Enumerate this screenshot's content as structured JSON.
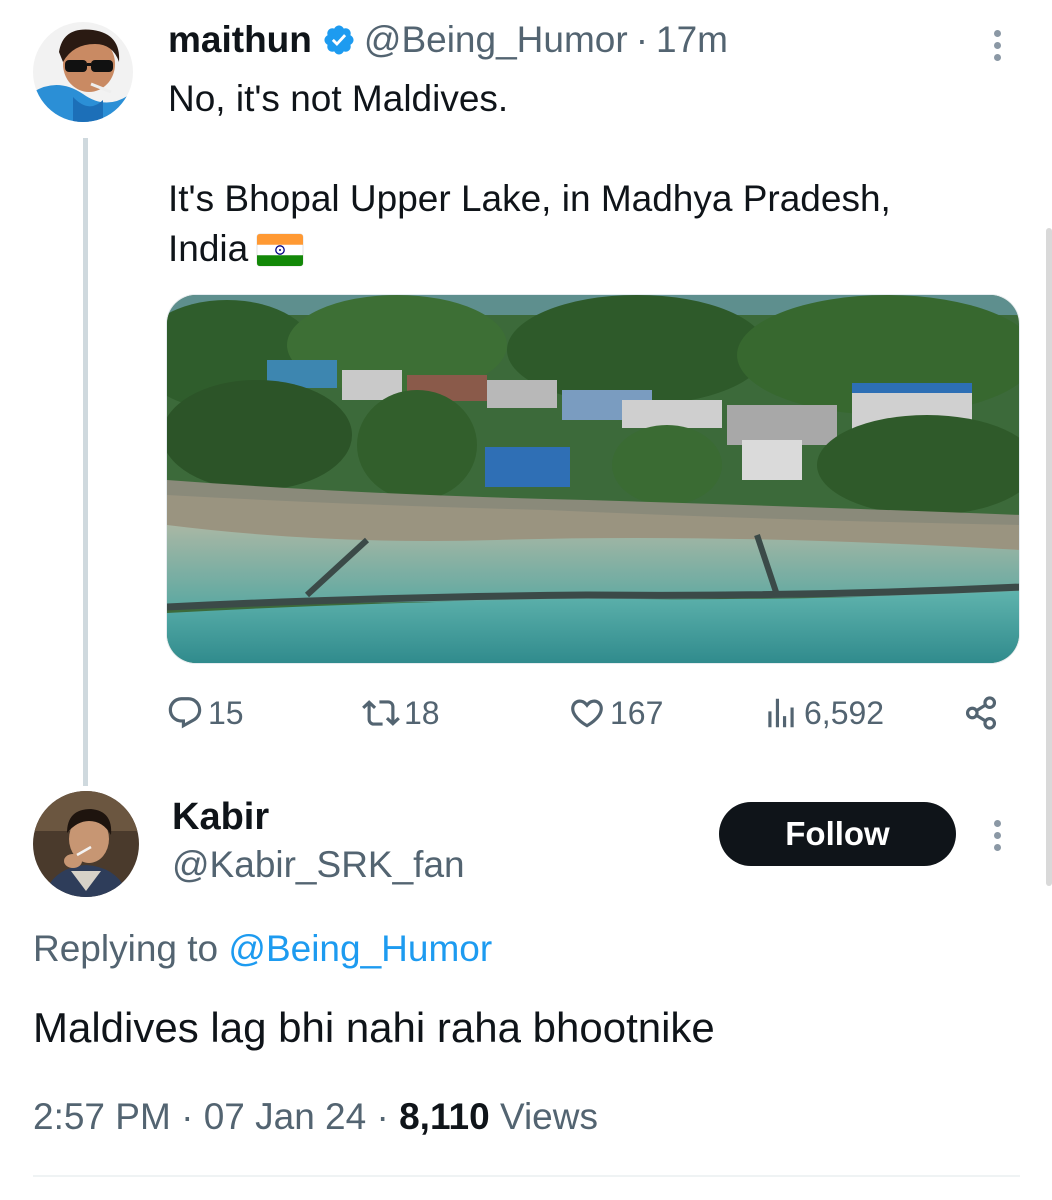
{
  "parent_tweet": {
    "display_name": "maithun",
    "verified": true,
    "handle": "@Being_Humor",
    "separator": "·",
    "time_ago": "17m",
    "text_line1": "No, it's not Maldives.",
    "text_line2": "It's Bhopal Upper Lake, in Madhya Pradesh,",
    "text_line3": "India",
    "flag_icon": "india-flag-icon",
    "image_icon": "lakeside-village-aerial-photo",
    "stats": {
      "replies": "15",
      "retweets": "18",
      "likes": "167",
      "views": "6,592"
    }
  },
  "reply_tweet": {
    "display_name": "Kabir",
    "handle": "@Kabir_SRK_fan",
    "follow_label": "Follow",
    "replying_prefix": "Replying to",
    "replying_to": "@Being_Humor",
    "text": "Maldives lag bhi nahi raha bhootnike",
    "time": "2:57 PM",
    "date": "07 Jan 24",
    "views_count": "8,110",
    "views_label": "Views",
    "separator": "·"
  },
  "colors": {
    "text": "#0f1419",
    "muted": "#536471",
    "link": "#1d9bf0",
    "verified": "#1d9bf0",
    "button_bg": "#0f1419",
    "thread_line": "#cfd9de"
  }
}
